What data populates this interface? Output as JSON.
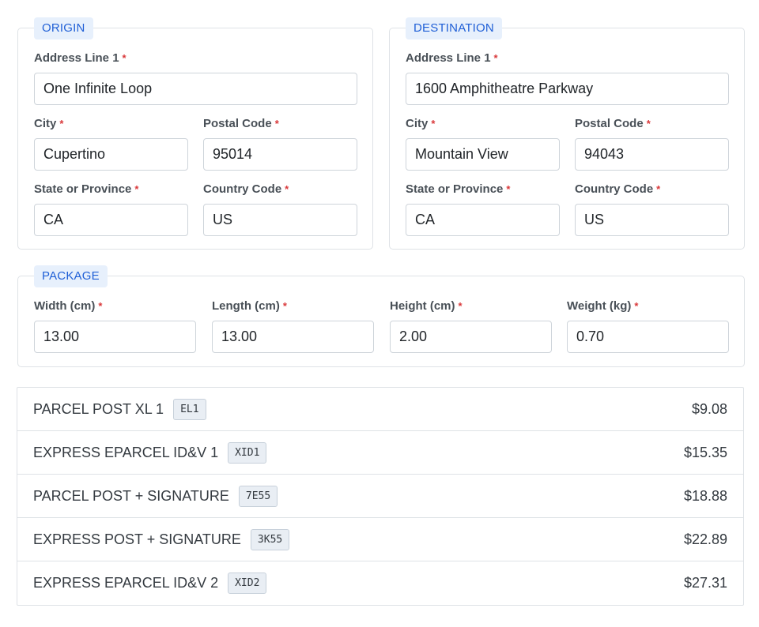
{
  "origin": {
    "legend": "ORIGIN",
    "address_label": "Address Line 1",
    "address_value": "One Infinite Loop",
    "city_label": "City",
    "city_value": "Cupertino",
    "postal_label": "Postal Code",
    "postal_value": "95014",
    "state_label": "State or Province",
    "state_value": "CA",
    "country_label": "Country Code",
    "country_value": "US"
  },
  "destination": {
    "legend": "DESTINATION",
    "address_label": "Address Line 1",
    "address_value": "1600 Amphitheatre Parkway",
    "city_label": "City",
    "city_value": "Mountain View",
    "postal_label": "Postal Code",
    "postal_value": "94043",
    "state_label": "State or Province",
    "state_value": "CA",
    "country_label": "Country Code",
    "country_value": "US"
  },
  "package": {
    "legend": "PACKAGE",
    "width_label": "Width (cm)",
    "width_value": "13.00",
    "length_label": "Length (cm)",
    "length_value": "13.00",
    "height_label": "Height (cm)",
    "height_value": "2.00",
    "weight_label": "Weight (kg)",
    "weight_value": "0.70"
  },
  "required_marker": "*",
  "rates": [
    {
      "name": "PARCEL POST XL 1",
      "code": "EL1",
      "price": "$9.08"
    },
    {
      "name": "EXPRESS EPARCEL ID&V 1",
      "code": "XID1",
      "price": "$15.35"
    },
    {
      "name": "PARCEL POST + SIGNATURE",
      "code": "7E55",
      "price": "$18.88"
    },
    {
      "name": "EXPRESS POST + SIGNATURE",
      "code": "3K55",
      "price": "$22.89"
    },
    {
      "name": "EXPRESS EPARCEL ID&V 2",
      "code": "XID2",
      "price": "$27.31"
    }
  ],
  "colors": {
    "legend_bg": "#e7f0fc",
    "legend_text": "#1f5fd6",
    "required": "#d9383a",
    "border": "#dee2e6"
  }
}
